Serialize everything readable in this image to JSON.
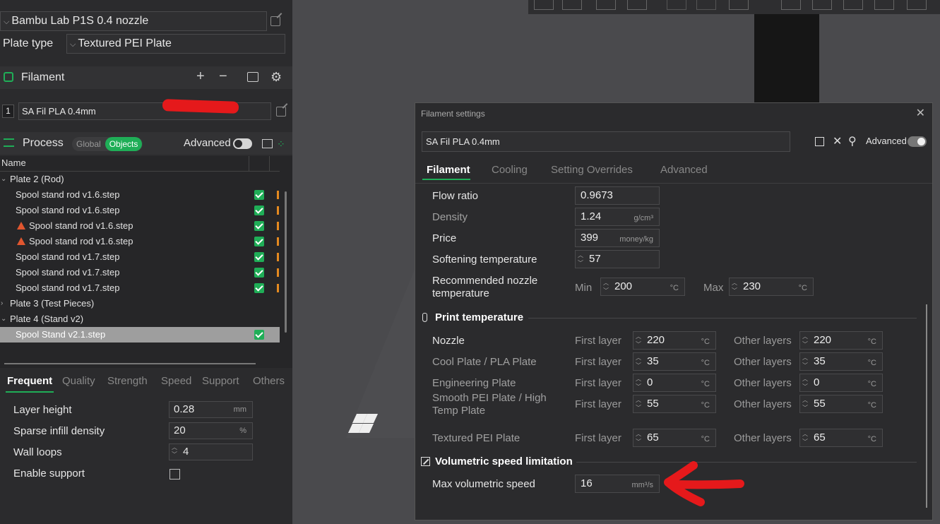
{
  "printer": {
    "value": "Bambu Lab P1S 0.4 nozzle"
  },
  "plate_type": {
    "label": "Plate type",
    "value": "Textured PEI Plate"
  },
  "filament": {
    "title": "Filament",
    "slot_number": "1",
    "preset": "SA Fil PLA 0.4mm"
  },
  "process": {
    "title": "Process",
    "mode_global": "Global",
    "mode_objects": "Objects",
    "advanced_label": "Advanced"
  },
  "objects": {
    "column_name": "Name",
    "rows": [
      {
        "label": "Plate 2 (Rod)",
        "expander": "⌄",
        "type": "plate"
      },
      {
        "label": "Spool stand rod v1.6.step",
        "type": "object"
      },
      {
        "label": "Spool stand rod v1.6.step",
        "type": "object"
      },
      {
        "label": "Spool stand rod v1.6.step",
        "type": "object-warn"
      },
      {
        "label": "Spool stand rod v1.6.step",
        "type": "object-warn"
      },
      {
        "label": "Spool stand rod v1.7.step",
        "type": "object"
      },
      {
        "label": "Spool stand rod v1.7.step",
        "type": "object"
      },
      {
        "label": "Spool stand rod v1.7.step",
        "type": "object"
      },
      {
        "label": "Plate 3 (Test Pieces)",
        "expander": "›",
        "type": "plate"
      },
      {
        "label": "Plate 4 (Stand v2)",
        "expander": "⌄",
        "type": "plate"
      },
      {
        "label": "Spool Stand v2.1.step",
        "type": "selected"
      }
    ]
  },
  "param_tabs": [
    "Frequent",
    "Quality",
    "Strength",
    "Speed",
    "Support",
    "Others"
  ],
  "params": {
    "layer_height": {
      "label": "Layer height",
      "value": "0.28",
      "unit": "mm"
    },
    "sparse_infill": {
      "label": "Sparse infill density",
      "value": "20",
      "unit": "%"
    },
    "wall_loops": {
      "label": "Wall loops",
      "value": "4"
    },
    "enable_support": {
      "label": "Enable support",
      "checked": false
    }
  },
  "dialog": {
    "title": "Filament settings",
    "close": "✕",
    "preset": "SA Fil PLA 0.4mm",
    "advanced_label": "Advanced",
    "tabs": [
      "Filament",
      "Cooling",
      "Setting Overrides",
      "Advanced"
    ],
    "flow_ratio": {
      "label": "Flow ratio",
      "value": "0.9673"
    },
    "density": {
      "label": "Density",
      "value": "1.24",
      "unit": "g/cm³"
    },
    "price": {
      "label": "Price",
      "value": "399",
      "unit": "money/kg"
    },
    "softening": {
      "label": "Softening temperature",
      "value": "57"
    },
    "nozzle_temp": {
      "label_line1": "Recommended nozzle",
      "label_line2": "temperature",
      "min_label": "Min",
      "min": "200",
      "max_label": "Max",
      "max": "230",
      "unit": "°C"
    },
    "print_temp_section": "Print temperature",
    "first_layer_label": "First layer",
    "other_layers_label": "Other layers",
    "temp_unit": "°C",
    "temps": [
      {
        "label": "Nozzle",
        "first": "220",
        "other": "220"
      },
      {
        "label": "Cool Plate / PLA Plate",
        "first": "35",
        "other": "35"
      },
      {
        "label": "Engineering Plate",
        "first": "0",
        "other": "0"
      },
      {
        "label_line1": "Smooth PEI Plate / High",
        "label_line2": "Temp Plate",
        "first": "55",
        "other": "55"
      },
      {
        "label": "Textured PEI Plate",
        "first": "65",
        "other": "65"
      }
    ],
    "volumetric_section": "Volumetric speed limitation",
    "max_vol": {
      "label": "Max volumetric speed",
      "value": "16",
      "unit": "mm³/s"
    }
  },
  "colors": {
    "accent": "#1fae57",
    "warning": "#e0562f",
    "annotation": "#e5191b"
  }
}
